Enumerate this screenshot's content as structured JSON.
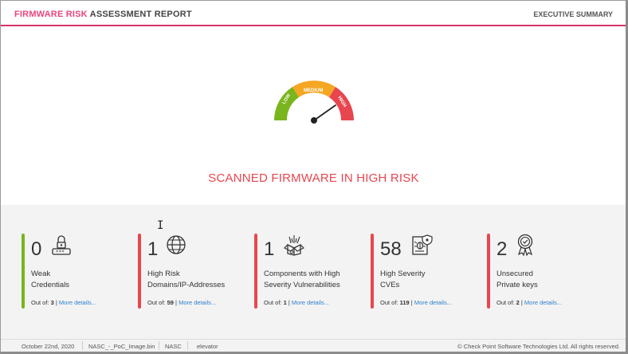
{
  "header": {
    "title_accent": "FIRMWARE RISK",
    "title_rest": " ASSESSMENT REPORT",
    "right_label": "EXECUTIVE SUMMARY"
  },
  "gauge": {
    "low_label": "LOW",
    "medium_label": "MEDIUM",
    "high_label": "HIGH",
    "colors": {
      "low": "#7ab51d",
      "medium": "#f5a623",
      "high": "#e8464f"
    },
    "level": "high"
  },
  "headline": "SCANNED FIRMWARE IN HIGH RISK",
  "cards": [
    {
      "value": "0",
      "label_line1": "Weak",
      "label_line2": "Credentials",
      "outof_prefix": "Out of: ",
      "outof_value": "3",
      "outof_sep": " | ",
      "more": "More details...",
      "icon": "lock-password-icon",
      "color": "#7ab51d"
    },
    {
      "value": "1",
      "label_line1": "High Risk",
      "label_line2": "Domains/IP-Addresses",
      "outof_prefix": "Out of: ",
      "outof_value": "59",
      "outof_sep": " | ",
      "more": "More details...",
      "icon": "globe-icon",
      "color": "#e8464f"
    },
    {
      "value": "1",
      "label_line1": "Components with High",
      "label_line2": "Severity Vulnerabilities",
      "outof_prefix": "Out of: ",
      "outof_value": "1",
      "outof_sep": " | ",
      "more": "More details...",
      "icon": "open-box-icon",
      "color": "#e8464f"
    },
    {
      "value": "58",
      "label_line1": "High Severity",
      "label_line2": "CVEs",
      "outof_prefix": "Out of: ",
      "outof_value": "119",
      "outof_sep": " | ",
      "more": "More details...",
      "icon": "bug-document-icon",
      "color": "#e8464f"
    },
    {
      "value": "2",
      "label_line1": "Unsecured",
      "label_line2": "Private keys",
      "outof_prefix": "Out of: ",
      "outof_value": "2",
      "outof_sep": " | ",
      "more": "More details...",
      "icon": "certificate-ribbon-icon",
      "color": "#e8464f"
    }
  ],
  "footer": {
    "date": "October 22nd, 2020",
    "file": "NASC_-_PoC_Image.bin",
    "vendor": "NASC",
    "device": "elevator",
    "copyright": "© Check Point Software Technologies Ltd. All rights reserved."
  }
}
